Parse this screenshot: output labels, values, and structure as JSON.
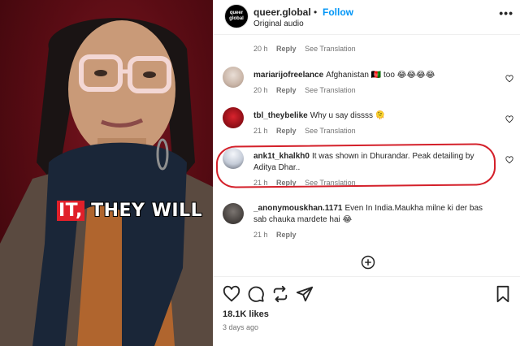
{
  "video": {
    "caption_highlight": "IT,",
    "caption_rest": " THEY WILL"
  },
  "header": {
    "avatar_text": "queer global",
    "username": "queer.global",
    "separator": "•",
    "follow_label": "Follow",
    "audio": "Original audio",
    "more": "•••"
  },
  "comments": [
    {
      "username": "",
      "text": "",
      "time": "20 h",
      "reply": "Reply",
      "see_translation": "See Translation"
    },
    {
      "username": "mariarijofreelance",
      "text": "Afghanistan 🇦🇫 too 😂😂😂😂",
      "time": "20 h",
      "reply": "Reply",
      "see_translation": "See Translation"
    },
    {
      "username": "tbl_theybelike",
      "text": "Why u say dissss 🫠",
      "time": "21 h",
      "reply": "Reply",
      "see_translation": "See Translation"
    },
    {
      "username": "ank1t_khalkh0",
      "text": "It was shown in Dhurandar. Peak detailing by Aditya Dhar..",
      "time": "21 h",
      "reply": "Reply",
      "see_translation": "See Translation"
    },
    {
      "username": "_anonymouskhan.1171",
      "text": "Even In India.Maukha milne ki der bas sab chauka mardete hai 😂",
      "time": "21 h",
      "reply": "Reply",
      "see_translation": ""
    }
  ],
  "likes": "18.1K likes",
  "posted": "3 days ago",
  "colors": {
    "follow": "#0095f6",
    "annotation": "#d4202a",
    "muted": "#737373"
  }
}
